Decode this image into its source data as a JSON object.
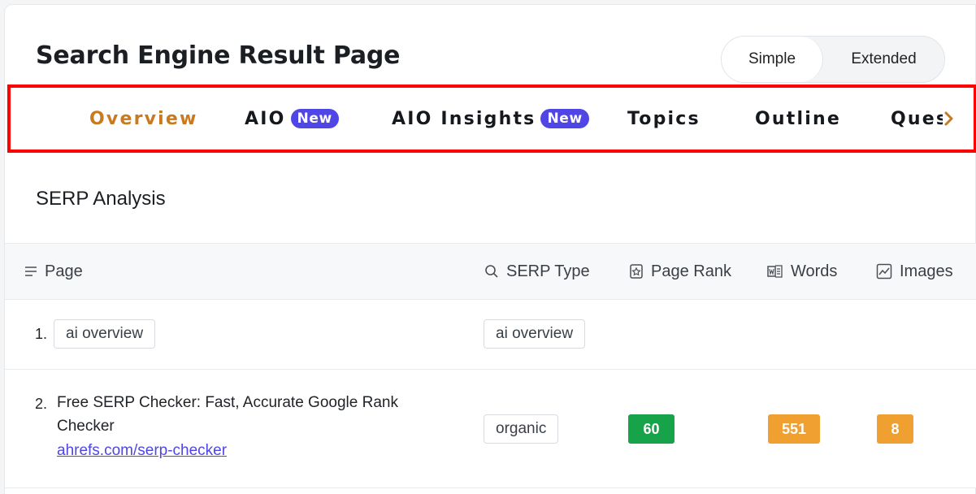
{
  "header": {
    "title": "Search Engine Result Page",
    "view_toggle": {
      "options": [
        "Simple",
        "Extended"
      ],
      "selected": "Simple"
    }
  },
  "tabs": {
    "items": [
      {
        "label": "Overview",
        "active": true
      },
      {
        "label": "AIO",
        "badge": "New"
      },
      {
        "label": "AIO Insights",
        "badge": "New"
      },
      {
        "label": "Topics"
      },
      {
        "label": "Outline"
      },
      {
        "label": "Questions"
      }
    ],
    "scroll_icon": "chevron-right-icon",
    "active_color": "#c97a1e",
    "badge_color": "#4f46e5",
    "highlight_color": "#ff0000"
  },
  "section": {
    "title": "SERP Analysis"
  },
  "table": {
    "columns": [
      {
        "label": "Page",
        "icon": "lines-icon"
      },
      {
        "label": "SERP Type",
        "icon": "search-icon"
      },
      {
        "label": "Page Rank",
        "icon": "rank-badge-icon"
      },
      {
        "label": "Words",
        "icon": "word-doc-icon"
      },
      {
        "label": "Images",
        "icon": "image-chart-icon"
      }
    ],
    "rows": [
      {
        "index": "1.",
        "page_chip": "ai overview",
        "serp_type": "ai overview"
      },
      {
        "index": "2.",
        "page_title": "Free SERP Checker: Fast, Accurate Google Rank Checker",
        "page_url": "ahrefs.com/serp-checker",
        "serp_type": "organic",
        "page_rank": "60",
        "words": "551",
        "images": "8"
      }
    ],
    "metric_colors": {
      "green": "#16a34a",
      "orange": "#f0a030"
    }
  }
}
